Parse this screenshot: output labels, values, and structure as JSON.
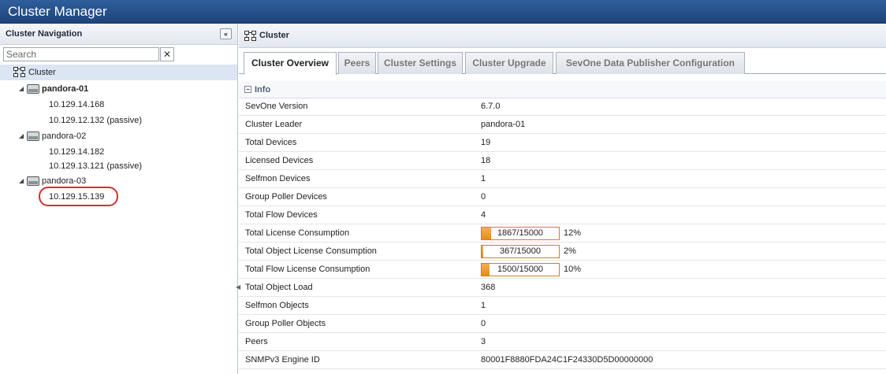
{
  "app": {
    "title": "Cluster Manager"
  },
  "nav": {
    "title": "Cluster Navigation",
    "collapse_glyph": "«",
    "search_placeholder": "Search",
    "clear_glyph": "✕",
    "tree": {
      "root": "Cluster",
      "nodes": [
        {
          "name": "pandora-01",
          "ips": [
            "10.129.14.168",
            "10.129.12.132 (passive)"
          ]
        },
        {
          "name": "pandora-02",
          "ips": [
            "10.129.14.182",
            "10.129.13.121 (passive)"
          ]
        },
        {
          "name": "pandora-03",
          "ips": [
            "10.129.15.139"
          ]
        }
      ]
    }
  },
  "main": {
    "title": "Cluster",
    "tabs": [
      {
        "label": "Cluster Overview"
      },
      {
        "label": "Peers"
      },
      {
        "label": "Cluster Settings"
      },
      {
        "label": "Cluster Upgrade"
      },
      {
        "label": "SevOne Data Publisher Configuration"
      }
    ],
    "section": {
      "title": "Info",
      "toggle": "−"
    },
    "info": {
      "sevone_version": {
        "label": "SevOne Version",
        "value": "6.7.0"
      },
      "cluster_leader": {
        "label": "Cluster Leader",
        "value": "pandora-01"
      },
      "total_devices": {
        "label": "Total Devices",
        "value": "19"
      },
      "licensed_devices": {
        "label": "Licensed Devices",
        "value": "18"
      },
      "selfmon_devices": {
        "label": "Selfmon Devices",
        "value": "1"
      },
      "group_poller_devices": {
        "label": "Group Poller Devices",
        "value": "0"
      },
      "total_flow_devices": {
        "label": "Total Flow Devices",
        "value": "4"
      },
      "total_license_consumption": {
        "label": "Total License Consumption",
        "bar_text": "1867/15000",
        "percent": "12%",
        "fraction": 0.12
      },
      "total_object_license_consumption": {
        "label": "Total Object License Consumption",
        "bar_text": "367/15000",
        "percent": "2%",
        "fraction": 0.02
      },
      "total_flow_license_consumption": {
        "label": "Total Flow License Consumption",
        "bar_text": "1500/15000",
        "percent": "10%",
        "fraction": 0.1
      },
      "total_object_load": {
        "label": "Total Object Load",
        "value": "368"
      },
      "selfmon_objects": {
        "label": "Selfmon Objects",
        "value": "1"
      },
      "group_poller_objects": {
        "label": "Group Poller Objects",
        "value": "0"
      },
      "peers": {
        "label": "Peers",
        "value": "3"
      },
      "snmpv3_engine_id": {
        "label": "SNMPv3 Engine ID",
        "value": "80001F8880FDA24C1F24330D5D00000000"
      }
    }
  },
  "colors": {
    "title_bar": "#1e4479",
    "bar_fill": "#e88a1a",
    "highlight": "#d42f2f",
    "selected_row": "#dbe5f3"
  }
}
